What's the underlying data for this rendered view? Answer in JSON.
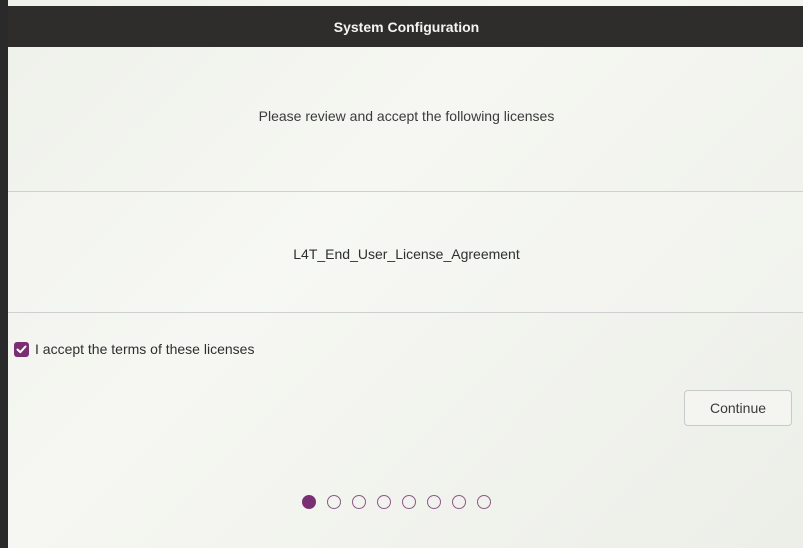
{
  "window": {
    "title": "System Configuration"
  },
  "main": {
    "heading": "Please review and accept the following licenses",
    "licenses": [
      {
        "label": "L4T_End_User_License_Agreement"
      }
    ],
    "accept_checkbox": {
      "label": "I accept the terms of these licenses",
      "checked": true
    },
    "continue_label": "Continue"
  },
  "pager": {
    "total_steps": 8,
    "current_step": 1
  },
  "colors": {
    "accent": "#7a2f73",
    "titlebar": "#2f2d2c"
  },
  "icons": {
    "checkbox": "check-icon",
    "pager": "step-dot"
  }
}
